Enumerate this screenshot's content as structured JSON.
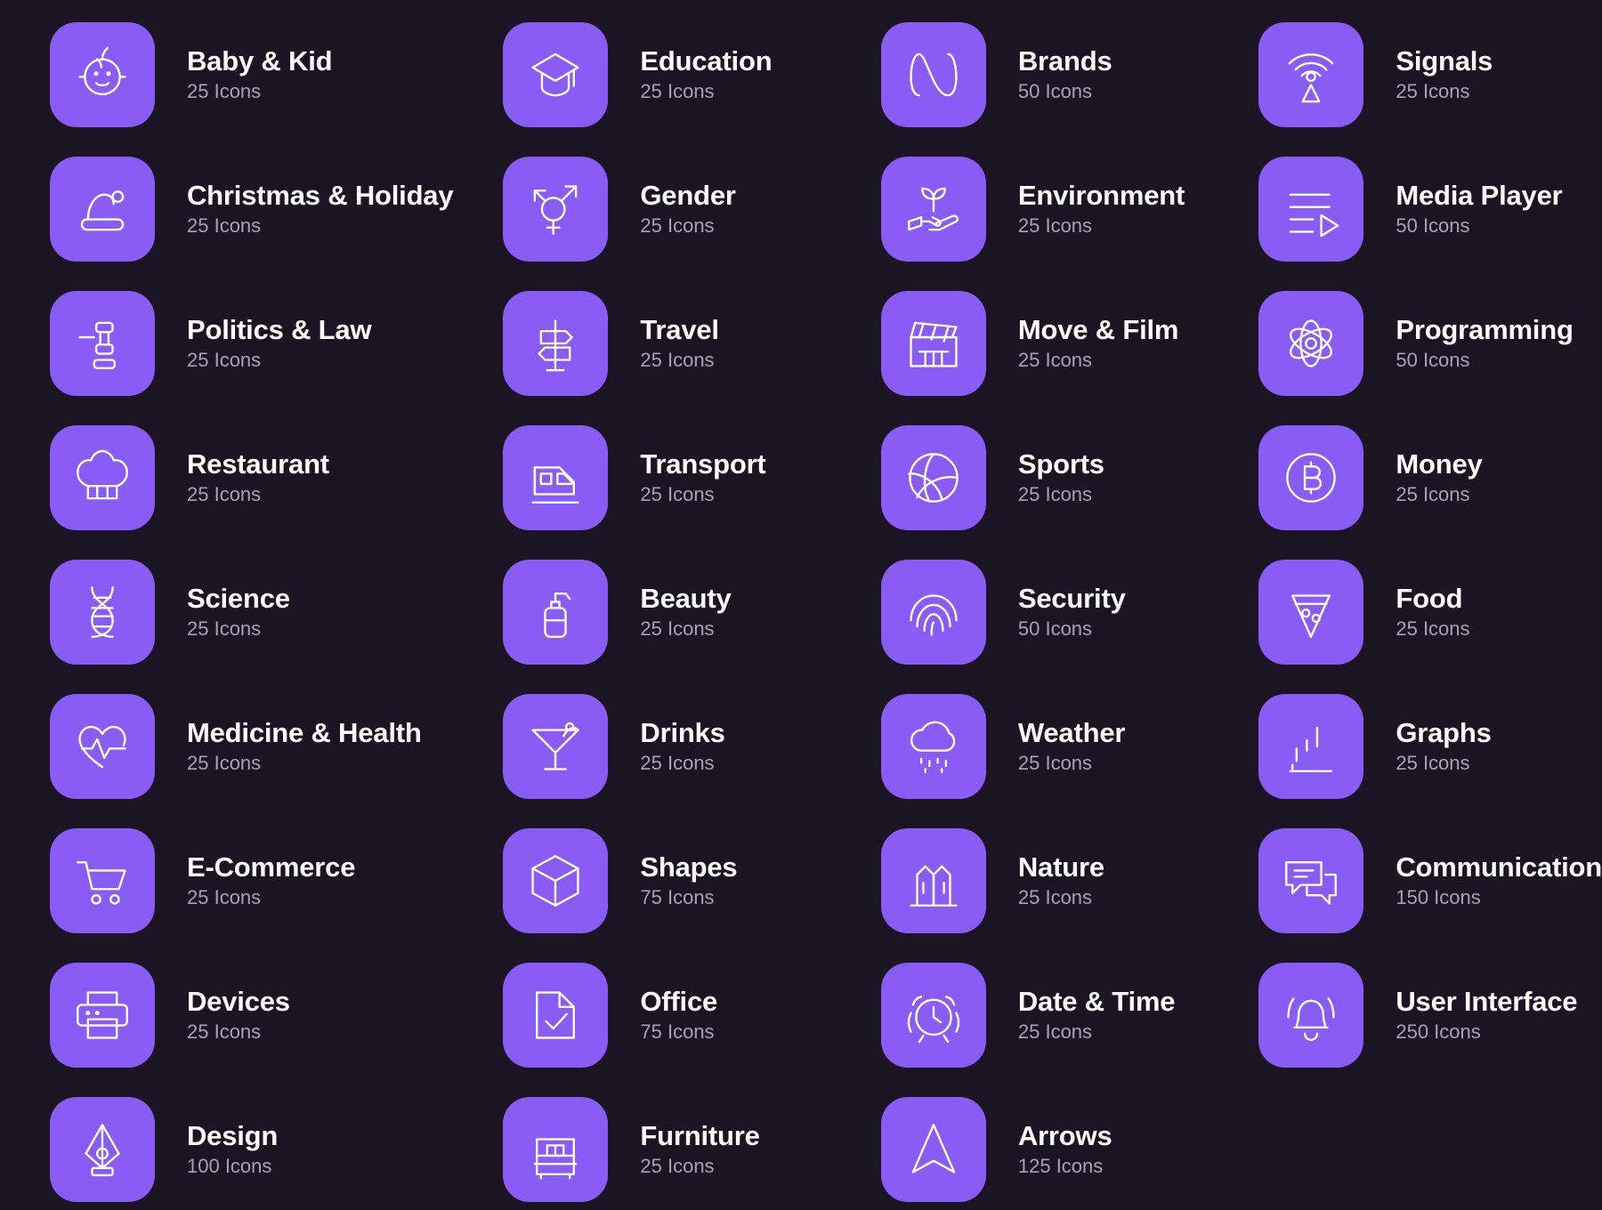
{
  "theme": {
    "background": "#1a1423",
    "tile_color": "#8a5cf6",
    "title_color": "#ffffff",
    "count_color": "#a8a2b8"
  },
  "grid": {
    "columns": 4,
    "rows": 9
  },
  "count_suffix": "Icons",
  "categories": [
    {
      "icon": "baby-face-icon",
      "title": "Baby & Kid",
      "count": "25 Icons"
    },
    {
      "icon": "graduation-cap-icon",
      "title": "Education",
      "count": "25 Icons"
    },
    {
      "icon": "infinity-brand-icon",
      "title": "Brands",
      "count": "50 Icons"
    },
    {
      "icon": "signal-broadcast-icon",
      "title": "Signals",
      "count": "25 Icons"
    },
    {
      "icon": "santa-hat-icon",
      "title": "Christmas & Holiday",
      "count": "25 Icons"
    },
    {
      "icon": "gender-symbols-icon",
      "title": "Gender",
      "count": "25 Icons"
    },
    {
      "icon": "plant-in-hand-icon",
      "title": "Environment",
      "count": "25 Icons"
    },
    {
      "icon": "media-playlist-icon",
      "title": "Media Player",
      "count": "50 Icons"
    },
    {
      "icon": "gavel-icon",
      "title": "Politics & Law",
      "count": "25 Icons"
    },
    {
      "icon": "signpost-icon",
      "title": "Travel",
      "count": "25 Icons"
    },
    {
      "icon": "clapperboard-icon",
      "title": "Move & Film",
      "count": "25 Icons"
    },
    {
      "icon": "atom-icon",
      "title": "Programming",
      "count": "50 Icons"
    },
    {
      "icon": "chef-hat-icon",
      "title": "Restaurant",
      "count": "25 Icons"
    },
    {
      "icon": "train-icon",
      "title": "Transport",
      "count": "25 Icons"
    },
    {
      "icon": "volleyball-icon",
      "title": "Sports",
      "count": "25 Icons"
    },
    {
      "icon": "bitcoin-coin-icon",
      "title": "Money",
      "count": "25 Icons"
    },
    {
      "icon": "dna-helix-icon",
      "title": "Science",
      "count": "25 Icons"
    },
    {
      "icon": "lotion-pump-icon",
      "title": "Beauty",
      "count": "25 Icons"
    },
    {
      "icon": "fingerprint-icon",
      "title": "Security",
      "count": "50 Icons"
    },
    {
      "icon": "pizza-slice-icon",
      "title": "Food",
      "count": "25 Icons"
    },
    {
      "icon": "heart-pulse-icon",
      "title": "Medicine & Health",
      "count": "25 Icons"
    },
    {
      "icon": "cocktail-glass-icon",
      "title": "Drinks",
      "count": "25 Icons"
    },
    {
      "icon": "rain-cloud-icon",
      "title": "Weather",
      "count": "25 Icons"
    },
    {
      "icon": "bar-chart-icon",
      "title": "Graphs",
      "count": "25 Icons"
    },
    {
      "icon": "shopping-cart-icon",
      "title": "E-Commerce",
      "count": "25 Icons"
    },
    {
      "icon": "cube-box-icon",
      "title": "Shapes",
      "count": "75 Icons"
    },
    {
      "icon": "factory-icon",
      "title": "Nature",
      "count": "25 Icons"
    },
    {
      "icon": "chat-bubbles-icon",
      "title": "Communication",
      "count": "150 Icons"
    },
    {
      "icon": "printer-icon",
      "title": "Devices",
      "count": "25 Icons"
    },
    {
      "icon": "document-check-icon",
      "title": "Office",
      "count": "75 Icons"
    },
    {
      "icon": "alarm-clock-icon",
      "title": "Date & Time",
      "count": "25 Icons"
    },
    {
      "icon": "bell-ringing-icon",
      "title": "User Interface",
      "count": "250 Icons"
    },
    {
      "icon": "fountain-pen-nib-icon",
      "title": "Design",
      "count": "100 Icons"
    },
    {
      "icon": "bed-icon",
      "title": "Furniture",
      "count": "25 Icons"
    },
    {
      "icon": "navigation-arrow-icon",
      "title": "Arrows",
      "count": "125 Icons"
    }
  ]
}
